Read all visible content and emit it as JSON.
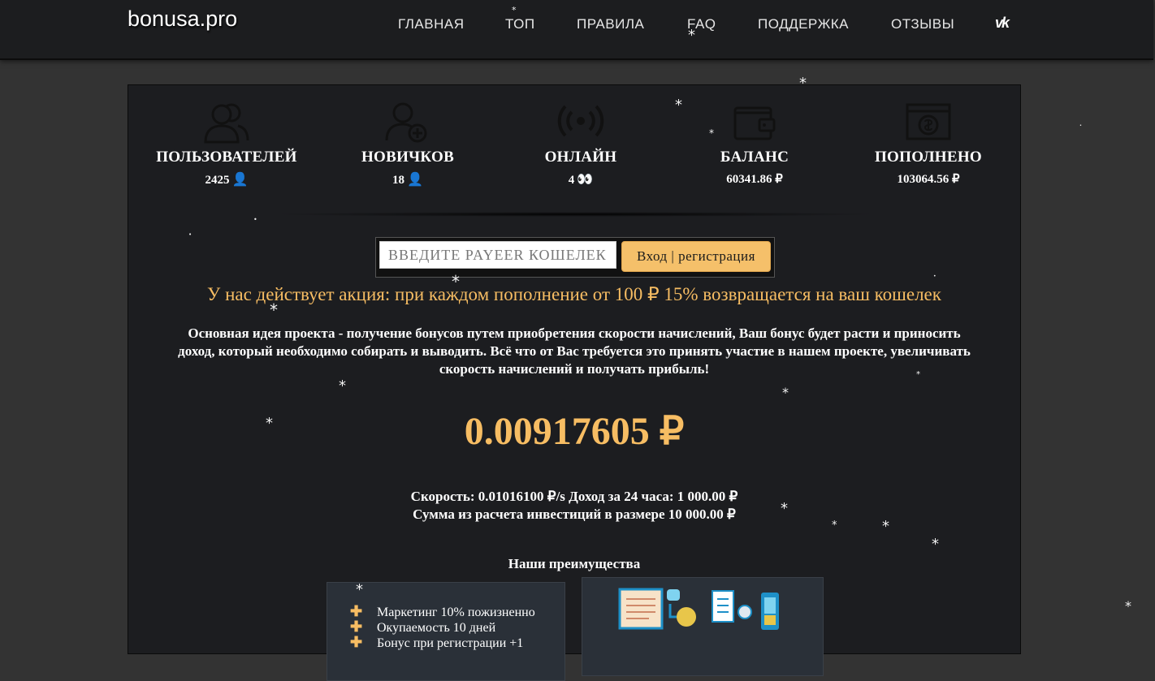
{
  "header": {
    "logo": "bonusa.pro",
    "nav": [
      "ГЛАВНАЯ",
      "ТОП",
      "ПРАВИЛА",
      "FAQ",
      "ПОДДЕРЖКА",
      "ОТЗЫВЫ"
    ],
    "social_icon": "vk-icon",
    "social_label": "vk"
  },
  "stats": [
    {
      "label": "ПОЛЬЗОВАТЕЛЕЙ",
      "value": "2425",
      "icon": "users-icon",
      "emoji": "👤"
    },
    {
      "label": "НОВИЧКОВ",
      "value": "18",
      "icon": "new-user-icon",
      "emoji": "👤"
    },
    {
      "label": "ОНЛАЙН",
      "value": "4",
      "icon": "broadcast-icon",
      "emoji": "👀"
    },
    {
      "label": "БАЛАНС",
      "value": "60341.86 ₽",
      "icon": "wallet-icon"
    },
    {
      "label": "ПОПОЛНЕНО",
      "value": "103064.56 ₽",
      "icon": "money-icon"
    }
  ],
  "login": {
    "placeholder": "ВВЕДИТЕ PAYEER КОШЕЛЕК",
    "button": "Вход | регистрация"
  },
  "promo": "У нас действует акция: при каждом пополнение от 100 ₽ 15% возвращается на ваш кошелек",
  "description": "Основная идея проекта - получение бонусов путем приобретения скорости начислений, Ваш бонус будет расти и приносить доход, который необходимо собирать и выводить. Всё что от Вас требуется это принять участие в нашем проекте, увеличивать скорость начислений и получать прибыль!",
  "balance": "0.00917605 ₽",
  "speed_line": "Скорость: 0.01016100 ₽/s Доход за 24 часа: 1 000.00 ₽",
  "invest_line": "Сумма из расчета инвестиций в размере 10 000.00 ₽",
  "advantages": {
    "title": "Наши преимущества",
    "items": [
      "Маркетинг 10% пожизненно",
      "Окупаемость 10 дней",
      "Бонус при регистрации +1"
    ]
  },
  "colors": {
    "accent": "#f7bd63",
    "panel": "#1c1d20",
    "page": "#333333"
  }
}
